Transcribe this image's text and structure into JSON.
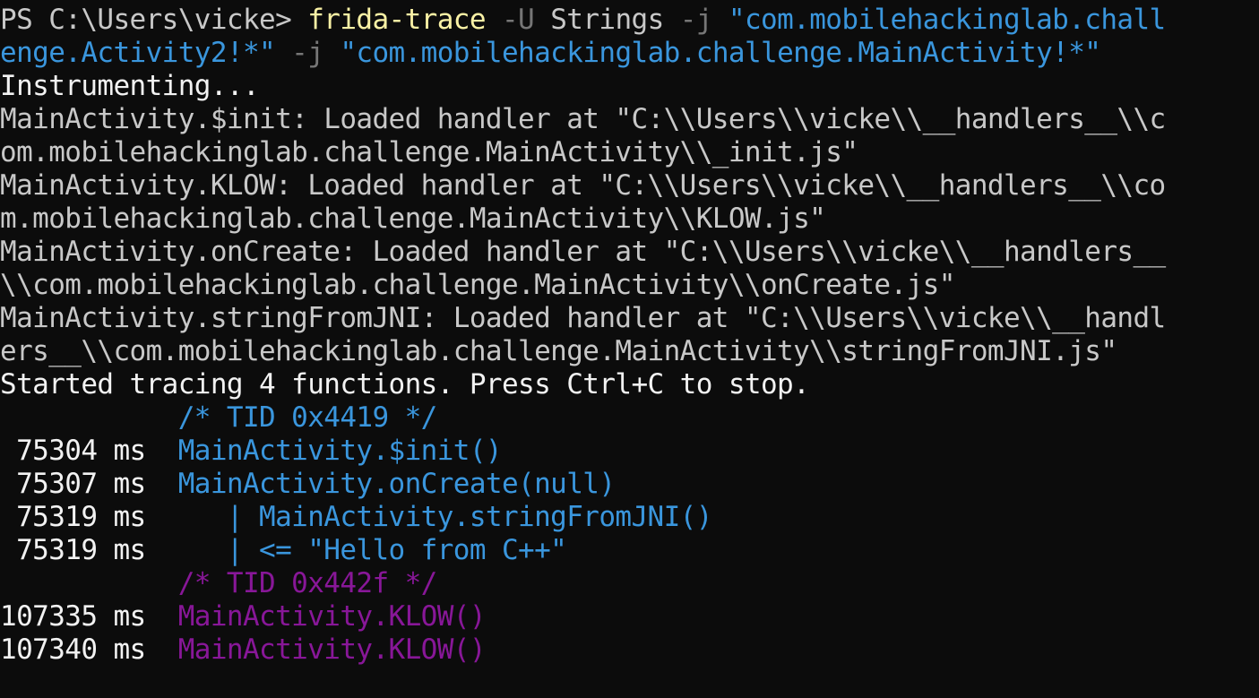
{
  "colors": {
    "background": "#0c0c0c",
    "default_text": "#cccccc",
    "bright_white": "#f2f2f2",
    "command_yellow": "#f9f1a5",
    "string_blue": "#3a96dd",
    "thread2_purple": "#881798",
    "flag_gray": "#767676"
  },
  "prompt": {
    "ps": "PS C:\\Users\\vicke> ",
    "cmd": "frida-trace",
    "flag_u": " -U",
    "arg_strings": " Strings",
    "flag_j1": " -j",
    "arg_j1_part1": " \"com.mobilehackinglab.chall",
    "arg_j1_part2": "enge.Activity2!*\"",
    "flag_j2": " -j",
    "arg_j2": " \"com.mobilehackinglab.challenge.MainActivity!*\""
  },
  "output": {
    "instrumenting": "Instrumenting...",
    "handlers": [
      "MainActivity.$init: Loaded handler at \"C:\\\\Users\\\\vicke\\\\__handlers__\\\\c",
      "om.mobilehackinglab.challenge.MainActivity\\\\_init.js\"",
      "MainActivity.KLOW: Loaded handler at \"C:\\\\Users\\\\vicke\\\\__handlers__\\\\co",
      "m.mobilehackinglab.challenge.MainActivity\\\\KLOW.js\"",
      "MainActivity.onCreate: Loaded handler at \"C:\\\\Users\\\\vicke\\\\__handlers__",
      "\\\\com.mobilehackinglab.challenge.MainActivity\\\\onCreate.js\"",
      "MainActivity.stringFromJNI: Loaded handler at \"C:\\\\Users\\\\vicke\\\\__handl",
      "ers__\\\\com.mobilehackinglab.challenge.MainActivity\\\\stringFromJNI.js\""
    ],
    "started": "Started tracing 4 functions. Press Ctrl+C to stop."
  },
  "trace": {
    "thread1_header": "           /* TID 0x4419 */",
    "thread1_rows": [
      {
        "time": " 75304 ms  ",
        "call": "MainActivity.$init()"
      },
      {
        "time": " 75307 ms  ",
        "call": "MainActivity.onCreate(null)"
      },
      {
        "time": " 75319 ms  ",
        "call": "   | MainActivity.stringFromJNI()"
      },
      {
        "time": " 75319 ms  ",
        "call": "   | <= \"Hello from C++\""
      }
    ],
    "thread2_header": "           /* TID 0x442f */",
    "thread2_rows": [
      {
        "time": "107335 ms  ",
        "call": "MainActivity.KLOW()"
      },
      {
        "time": "107340 ms  ",
        "call": "MainActivity.KLOW()"
      }
    ]
  }
}
